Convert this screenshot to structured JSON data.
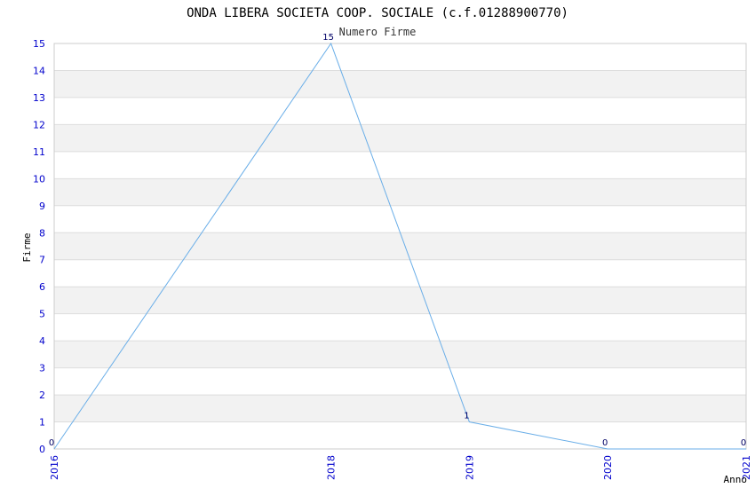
{
  "colors": {
    "line": "#6aaee8",
    "band": "#f2f2f2",
    "grid": "#dddddd",
    "tick_text": "#0000cc",
    "data_label_text": "#000066"
  },
  "chart_data": {
    "type": "line",
    "title": "ONDA LIBERA SOCIETA COOP. SOCIALE (c.f.01288900770)",
    "subtitle": "Numero Firme",
    "xlabel": "Anno",
    "ylabel": "Firme",
    "x": [
      "2016",
      "2018",
      "2019",
      "2020",
      "2021"
    ],
    "values": [
      0,
      15,
      1,
      0,
      0
    ],
    "data_labels": [
      "0",
      "15",
      "1",
      "0",
      "0"
    ],
    "y_ticks": [
      "0",
      "1",
      "2",
      "3",
      "4",
      "5",
      "6",
      "7",
      "8",
      "9",
      "10",
      "11",
      "12",
      "13",
      "14",
      "15"
    ],
    "ylim": [
      0,
      15
    ],
    "grid": true,
    "legend": "none"
  }
}
